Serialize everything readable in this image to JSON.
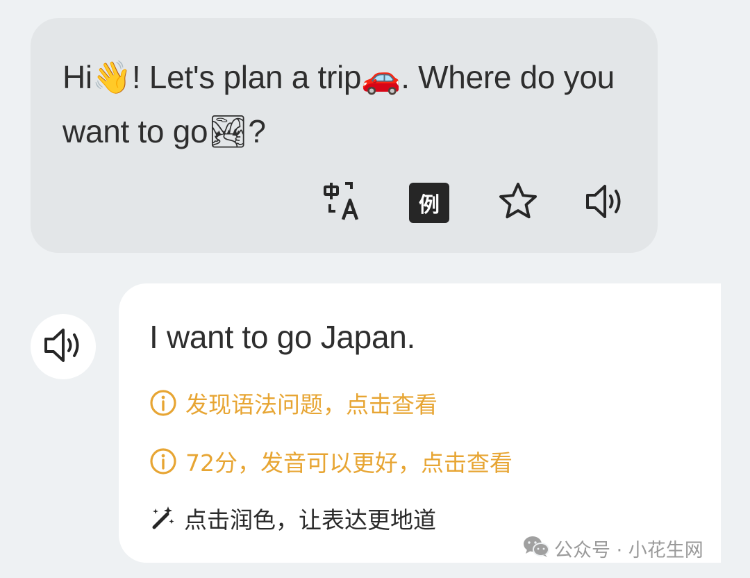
{
  "ai_message": {
    "part1": "Hi",
    "emoji_wave": "👋",
    "part2": "! Let's plan a trip",
    "emoji_car": "🚗",
    "part3": ". Where do you want to go",
    "emoji_landscape": "🏞",
    "part4": "?",
    "tools": {
      "translate_icon": "translate-icon",
      "example_label": "例",
      "star_icon": "star-icon",
      "speaker_icon": "speaker-icon"
    }
  },
  "user_message": {
    "speaker_icon": "speaker-icon",
    "text": "I want to go Japan.",
    "grammar_hint": "发现语法问题，点击查看",
    "pronunciation_hint": "72分，发音可以更好，点击查看",
    "polish_hint": "点击润色，让表达更地道"
  },
  "colors": {
    "page_bg": "#eef1f3",
    "ai_bubble_bg": "#e3e6e8",
    "user_bubble_bg": "#ffffff",
    "warning": "#e7a533",
    "text": "#2e2e2e"
  },
  "watermark": {
    "text": "公众号 · 小花生网"
  }
}
